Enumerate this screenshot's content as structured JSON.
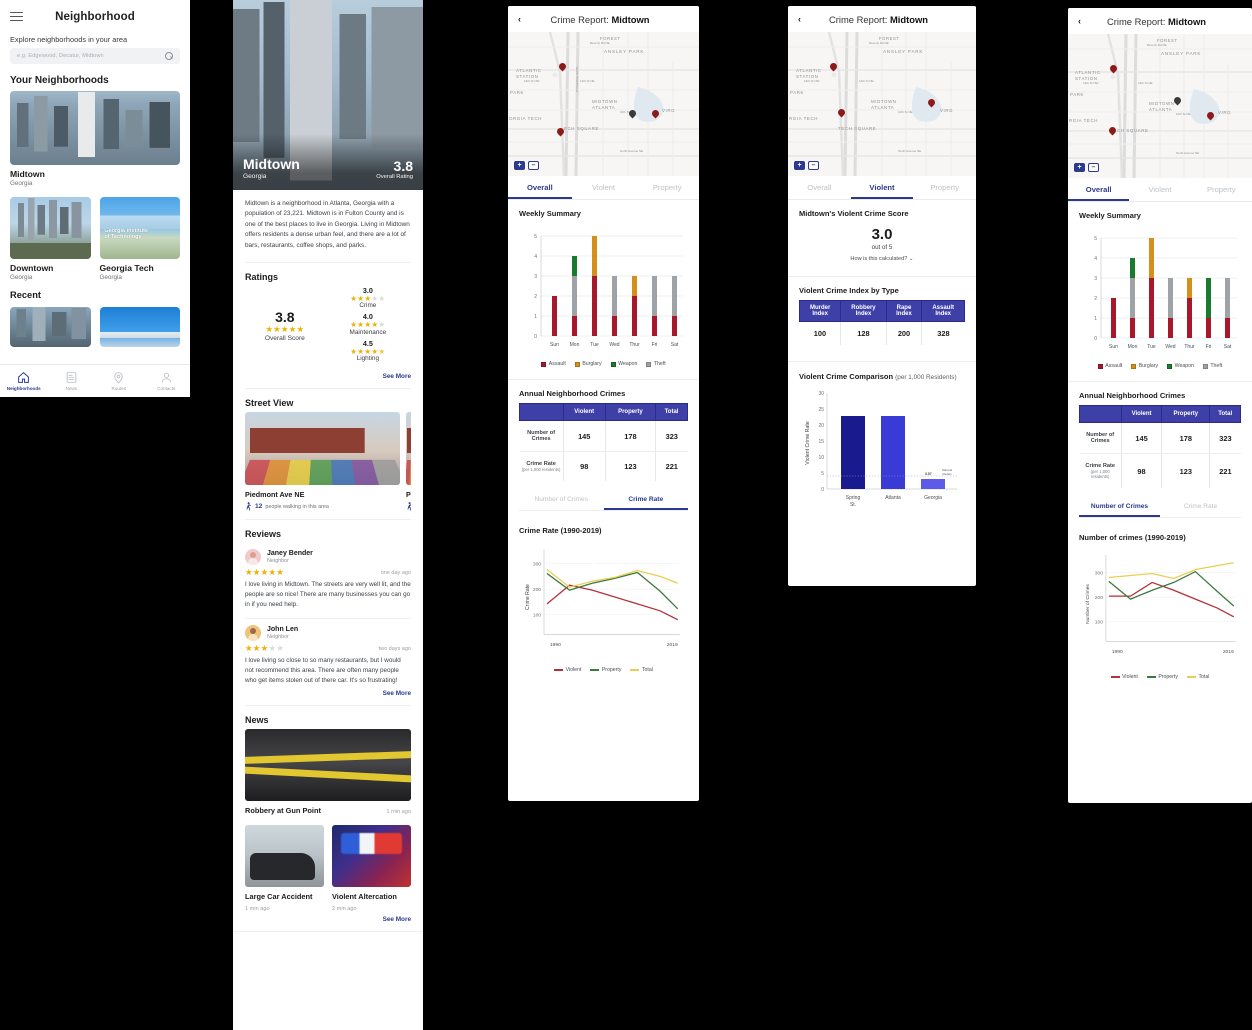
{
  "panel1": {
    "header_title": "Neighborhood",
    "menu_icon": "hamburger-icon",
    "subtitle": "Explore neighborhoods in your area",
    "search_placeholder": "e.g.  Edgewood, Decatur, Midtown",
    "search_value": "",
    "search_icon": "search-icon",
    "your_neighborhoods_title": "Your Neighborhoods",
    "recent_title": "Recent",
    "cards": [
      {
        "name": "Midtown",
        "region": "Georgia"
      },
      {
        "name": "Downtown",
        "region": "Georgia"
      },
      {
        "name": "Georgia Tech",
        "region": "Georgia",
        "watermark": "Georgia Institute\nof Technology"
      }
    ],
    "nav": [
      {
        "label": "Neighborhoods",
        "icon": "home-icon",
        "active": true
      },
      {
        "label": "News",
        "icon": "news-icon",
        "active": false
      },
      {
        "label": "Routes",
        "icon": "map-pin-icon",
        "active": false
      },
      {
        "label": "Contacts",
        "icon": "person-icon",
        "active": false
      }
    ]
  },
  "panel2": {
    "hero": {
      "name": "Midtown",
      "state": "Georgia",
      "rating": "3.8",
      "rating_caption": "Overall Rating"
    },
    "description": "Midtown is a neighborhood in Atlanta, Georgia with a population of 23,221. Midtown is in Fulton County and is one of the best places to live in Georgia. Living in Midtown offers residents a dense urban feel, and there are a lot of bars, restaurants, coffee shops, and parks.",
    "ratings": {
      "title": "Ratings",
      "overall_value": "3.8",
      "overall_caption": "Overall Score",
      "overall_stars": 5,
      "items": [
        {
          "value": "3.0",
          "caption": "Crime",
          "stars": 3
        },
        {
          "value": "4.0",
          "caption": "Maintenance",
          "stars": 4
        },
        {
          "value": "4.5",
          "caption": "Lighting",
          "stars": 4.5
        }
      ],
      "see_more": "See More"
    },
    "street_view": {
      "title": "Street View",
      "cards": [
        {
          "title": "Piedmont Ave NE",
          "count": "12",
          "meta": "people walking in this area",
          "icon": "walking-person-icon"
        },
        {
          "title": "P",
          "count": "",
          "meta": "",
          "icon": "walking-person-icon"
        }
      ]
    },
    "reviews": {
      "title": "Reviews",
      "see_more": "See More",
      "items": [
        {
          "name": "Janey Bender",
          "role": "Neighbor",
          "stars": 5,
          "ago": "one day ago",
          "text": "I love living in Midtown. The streets are very well lit, and the people are so nice! There are many businesses you can go in if you need help."
        },
        {
          "name": "John Len",
          "role": "Neighbor",
          "stars": 3,
          "ago": "two days ago",
          "text": "I love living so close to so many restaurants, but I would not recommend this area. There are often many people who get items stolen out of there car. It's so frustrating!"
        }
      ]
    },
    "news": {
      "title": "News",
      "see_more": "See More",
      "featured": {
        "title": "Robbery at Gun Point",
        "ago": "1 min ago"
      },
      "items": [
        {
          "title": "Large Car Accident",
          "ago": "1 min ago"
        },
        {
          "title": "Violent Altercation",
          "ago": "2 min ago"
        }
      ]
    }
  },
  "crime_common": {
    "title_prefix": "Crime Report: ",
    "title_name": "Midtown",
    "back_icon": "chevron-left-icon",
    "zoom_in": "+",
    "zoom_out": "–",
    "tabs": [
      "Overall",
      "Violent",
      "Property"
    ],
    "map_labels": [
      "FOREST",
      "ANSLEY PARK",
      "ATLANTIC STATION",
      "MIDTOWN ATLANTA",
      "PARK",
      "ORGIA TECH",
      "TECH SQUARE",
      "VIRG",
      "Beverly Rd NE",
      "Spring St NW",
      "14th St NW",
      "14th St NE",
      "10th St NE",
      "North Avenue NE",
      "W Peachtree St NW",
      "Piedmont Ave NE",
      "Juniper St NE",
      "Monroe Dr NE"
    ]
  },
  "panel3": {
    "active_tab": "Overall",
    "weekly_title": "Weekly Summary",
    "annual_title": "Annual Neighborhood Crimes",
    "table": {
      "columns": [
        "",
        "Violent",
        "Property",
        "Total"
      ],
      "rows": [
        {
          "label": "Number of Crimes",
          "sub": "",
          "values": [
            "145",
            "178",
            "323"
          ]
        },
        {
          "label": "Crime Rate",
          "sub": "(per 1,000 residents)",
          "values": [
            "98",
            "123",
            "221"
          ]
        }
      ]
    },
    "subtabs": [
      {
        "label": "Number of Crimes",
        "active": false
      },
      {
        "label": "Crime Rate",
        "active": true
      }
    ],
    "chart_data": [
      {
        "type": "bar",
        "title": "Weekly Summary",
        "categories": [
          "Sun",
          "Mon",
          "Tue",
          "Wed",
          "Thur",
          "Fri",
          "Sat"
        ],
        "series": [
          {
            "name": "Assault",
            "color": "#a6182a",
            "values": [
              2,
              1,
              3,
              1,
              2,
              1,
              1
            ]
          },
          {
            "name": "Burglary",
            "color": "#d4901a",
            "values": [
              0,
              0,
              2,
              0,
              1,
              0,
              0
            ]
          },
          {
            "name": "Weapon",
            "color": "#1a7a2e",
            "values": [
              0,
              1,
              0,
              0,
              0,
              0,
              0
            ]
          },
          {
            "name": "Theft",
            "color": "#9fa2a6",
            "values": [
              0,
              2,
              0,
              2,
              0,
              2,
              2
            ]
          }
        ],
        "ylim": [
          0,
          5
        ],
        "yticks": [
          0,
          1,
          2,
          3,
          4,
          5
        ],
        "ylabel": "",
        "xlabel": "",
        "stacked": true,
        "legend": "bottom"
      },
      {
        "type": "line",
        "title": "Crime Rate (1990-2019)",
        "ylabel": "Crime Rate",
        "x": [
          "1990",
          "2019"
        ],
        "xticks": [
          "1990",
          "2019"
        ],
        "yticks": [
          100,
          200,
          300
        ],
        "ylim": [
          40,
          330
        ],
        "series": [
          {
            "name": "Violent",
            "color": "#b5303a",
            "values": [
              140,
              207,
              185,
              160,
              133,
              110,
              85
            ]
          },
          {
            "name": "Property",
            "color": "#3d7a3d",
            "values": [
              262,
              196,
              222,
              242,
              259,
              188,
              120
            ]
          },
          {
            "name": "Total",
            "color": "#e8cf52",
            "values": [
              278,
              210,
              232,
              250,
              266,
              245,
              223
            ]
          },
          {
            "name": "_x_",
            "color": "",
            "values": [
              0,
              1,
              2,
              3,
              4,
              5,
              6
            ]
          }
        ],
        "legend": "bottom",
        "grid": true
      }
    ]
  },
  "panel4": {
    "active_tab": "Violent",
    "score_title": "Midtown's Violent Crime Score",
    "score_value": "3.0",
    "score_out_of": "out of 5",
    "score_question": "How is this calculated?",
    "chevron_icon": "chevron-down-icon",
    "index_title": "Violent Crime Index by Type",
    "index_table": {
      "columns": [
        "Murder Index",
        "Robbery Index",
        "Rape Index",
        "Assault Index"
      ],
      "values": [
        "100",
        "128",
        "200",
        "328"
      ]
    },
    "comparison_title": "Violent Crime Comparison",
    "comparison_subtitle": "(per 1,000 Residents)",
    "chart_data": {
      "type": "bar",
      "title": "Violent Crime Comparison (per 1,000 Residents)",
      "ylabel": "Violent Crime Rate",
      "categories": [
        "Spring St.",
        "Atlanta",
        "Georgia"
      ],
      "values": [
        22.8,
        22.8,
        3.07
      ],
      "colors": [
        "#1a1a8f",
        "#3a3ad6",
        "#5c5ce8"
      ],
      "ylim": [
        0,
        30
      ],
      "yticks": [
        0,
        5,
        10,
        15,
        20,
        25,
        30
      ],
      "annotations": [
        {
          "text": "3.07",
          "value": 3.07
        },
        {
          "text": "National Median",
          "value": 4.0
        }
      ]
    }
  },
  "panel5": {
    "active_tab": "Overall",
    "weekly_title": "Weekly Summary",
    "annual_title": "Annual Neighborhood Crimes",
    "table": {
      "columns": [
        "",
        "Violent",
        "Property",
        "Total"
      ],
      "rows": [
        {
          "label": "Number of Crimes",
          "sub": "",
          "values": [
            "145",
            "178",
            "323"
          ]
        },
        {
          "label": "Crime Rate",
          "sub": "(per 1,000 residents)",
          "values": [
            "98",
            "123",
            "221"
          ]
        }
      ]
    },
    "subtabs": [
      {
        "label": "Number of Crimes",
        "active": true
      },
      {
        "label": "Crime Rate",
        "active": false
      }
    ],
    "chart_data": [
      {
        "type": "bar",
        "title": "Weekly Summary",
        "categories": [
          "Sun",
          "Mon",
          "Tue",
          "Wed",
          "Thur",
          "Fri",
          "Sat"
        ],
        "series": [
          {
            "name": "Assault",
            "color": "#a6182a",
            "values": [
              2,
              1,
              3,
              1,
              2,
              1,
              1
            ]
          },
          {
            "name": "Burglary",
            "color": "#d4901a",
            "values": [
              0,
              0,
              2,
              0,
              1,
              0,
              0
            ]
          },
          {
            "name": "Weapon",
            "color": "#1a7a2e",
            "values": [
              0,
              1,
              0,
              0,
              0,
              2,
              0
            ]
          },
          {
            "name": "Theft",
            "color": "#9fa2a6",
            "values": [
              0,
              2,
              0,
              2,
              0,
              0,
              2
            ]
          }
        ],
        "ylim": [
          0,
          5
        ],
        "yticks": [
          0,
          1,
          2,
          3,
          4,
          5
        ],
        "stacked": true,
        "legend": "bottom"
      },
      {
        "type": "line",
        "title": "Number of crimes (1990-2019)",
        "ylabel": "Number of Crimes",
        "xticks": [
          "1990",
          "2019"
        ],
        "yticks": [
          100,
          200,
          300
        ],
        "ylim": [
          60,
          345
        ],
        "series": [
          {
            "name": "Violent",
            "color": "#b5303a",
            "values": [
              207,
              207,
              262,
              240,
              213,
              178,
              143
            ]
          },
          {
            "name": "Property",
            "color": "#3d7a3d",
            "values": [
              262,
              196,
              240,
              272,
              307,
              230,
              165
            ]
          },
          {
            "name": "Total",
            "color": "#e8cf52",
            "values": [
              278,
              288,
              295,
              277,
              312,
              322,
              330
            ]
          }
        ],
        "legend": "bottom",
        "grid": true
      }
    ]
  },
  "colors": {
    "accent": "#2b3a8f",
    "table_header": "#3f3fa8",
    "assault": "#a6182a",
    "burglary": "#d4901a",
    "weapon": "#1a7a2e",
    "theft": "#9fa2a6",
    "violent_line": "#b5303a",
    "property_line": "#3d7a3d",
    "total_line": "#e8cf52",
    "star": "#f0b000"
  }
}
